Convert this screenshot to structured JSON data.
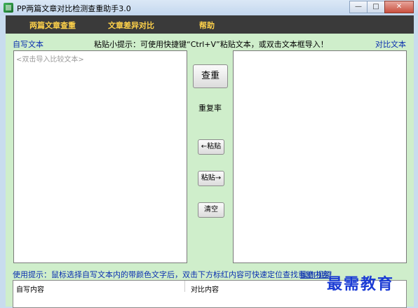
{
  "window": {
    "title": "PP两篇文章对比检测查重助手3.0",
    "minimize": "—",
    "maximize": "□",
    "close": "✕"
  },
  "menu": {
    "items": [
      "两篇文章查重",
      "文章差异对比",
      "帮助"
    ]
  },
  "labels": {
    "left_title": "自写文本",
    "right_title": "对比文本",
    "paste_hint": "粘贴小提示：可使用快捷键“Ctrl+V”粘贴文本，或双击文本框导入！"
  },
  "left_box": {
    "placeholder": "<双击导入比较文本>"
  },
  "buttons": {
    "check": "查重",
    "paste_left": "←粘贴",
    "paste_right": "粘贴→",
    "clear": "清空"
  },
  "rate_label": "重复率",
  "usage": {
    "hint": "使用提示：鼠标选择自写文本内的带颜色文字后，双击下方标红内容可快速定位查找重复内容！",
    "link": "操作视频"
  },
  "table": {
    "columns": [
      "自写内容",
      "对比内容"
    ]
  },
  "watermark": "最需教育"
}
